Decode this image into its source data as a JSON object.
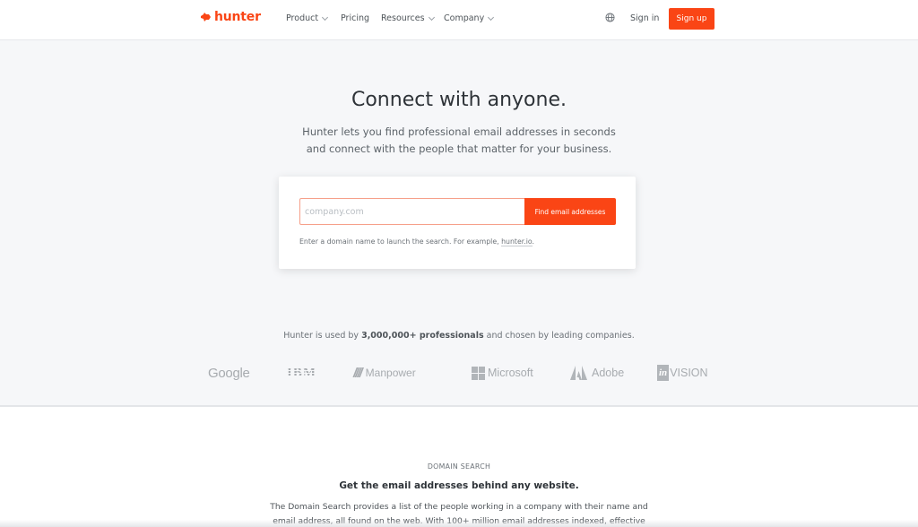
{
  "header": {
    "brand": "hunter",
    "nav": [
      {
        "label": "Product",
        "has_dropdown": true
      },
      {
        "label": "Pricing",
        "has_dropdown": false
      },
      {
        "label": "Resources",
        "has_dropdown": true
      },
      {
        "label": "Company",
        "has_dropdown": true
      }
    ],
    "language_icon": "globe-icon",
    "sign_in": "Sign in",
    "sign_up": "Sign up"
  },
  "hero": {
    "title": "Connect with anyone.",
    "subtitle_line1": "Hunter lets you find professional email addresses in seconds",
    "subtitle_line2": "and connect with the people that matter for your business.",
    "search": {
      "placeholder": "company.com",
      "value": "",
      "button": "Find email addresses",
      "hint_prefix": "Enter a domain name to launch the search. For example, ",
      "hint_link": "hunter.io",
      "hint_suffix": "."
    },
    "trust": {
      "prefix": "Hunter is used by ",
      "highlight": "3,000,000+ professionals",
      "suffix": " and chosen by leading companies."
    },
    "logos": [
      "Google",
      "IBM",
      "Manpower",
      "Microsoft",
      "Adobe",
      "InVision"
    ]
  },
  "domain_search": {
    "eyebrow": "DOMAIN SEARCH",
    "title": "Get the email addresses behind any website.",
    "body": "The Domain Search provides a list of the people working in a company with their name and email address, all found on the web. With 100+ million email addresses indexed, effective"
  },
  "colors": {
    "brand": "#fa4515",
    "hero_bg": "#f6f7f9",
    "text": "#2e3338"
  }
}
